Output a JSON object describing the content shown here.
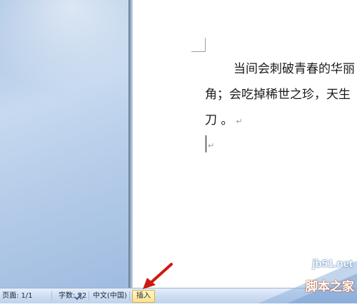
{
  "document": {
    "lines": [
      "当间会刺破青春的华丽",
      "角；会吃掉稀世之珍，天生",
      "刀 。"
    ],
    "paragraph_mark": "↵"
  },
  "statusbar": {
    "page": "页面: 1/1",
    "words": "字数: 52",
    "spell_icon": "spellcheck-icon",
    "language": "中文(中国)",
    "mode": "插入"
  },
  "watermark": {
    "domain": "jb51.net",
    "name": "脚本之家"
  },
  "colors": {
    "arrow": "#cc1a12",
    "insert_highlight": "#ffe28a",
    "statusbar": "#cdddf1"
  }
}
